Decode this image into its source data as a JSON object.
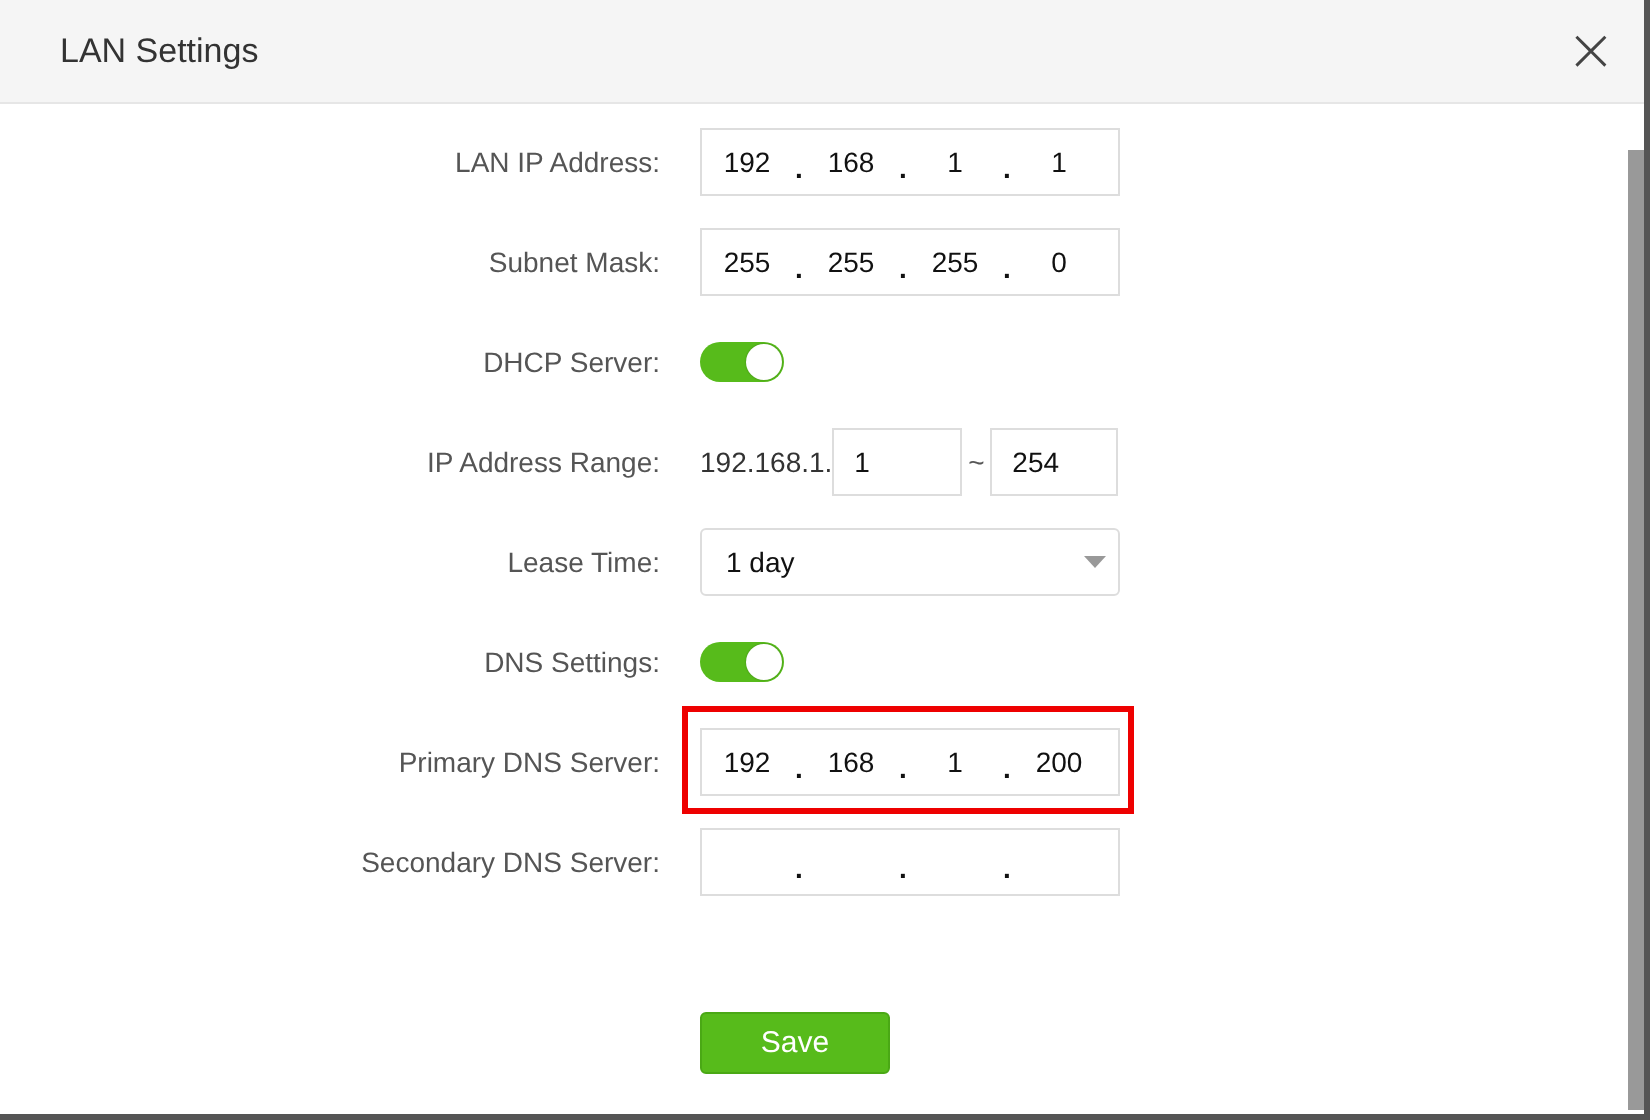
{
  "dialog": {
    "title": "LAN Settings",
    "close": "×"
  },
  "rows": [
    {
      "kind": "ip",
      "label": "LAN IP Address:",
      "separator": ".",
      "octets": [
        "192",
        "168",
        "1",
        "1"
      ],
      "highlighted": false
    },
    {
      "kind": "ip",
      "label": "Subnet Mask:",
      "separator": ".",
      "octets": [
        "255",
        "255",
        "255",
        "0"
      ],
      "highlighted": false
    },
    {
      "kind": "toggle",
      "label": "DHCP Server:",
      "on": true
    },
    {
      "kind": "range",
      "label": "IP Address Range:",
      "prefix": "192.168.1.",
      "start": "1",
      "between": "~",
      "end": "254"
    },
    {
      "kind": "select",
      "label": "Lease Time:",
      "value": "1 day"
    },
    {
      "kind": "toggle",
      "label": "DNS Settings:",
      "on": true
    },
    {
      "kind": "ip",
      "label": "Primary DNS Server:",
      "separator": ".",
      "octets": [
        "192",
        "168",
        "1",
        "200"
      ],
      "highlighted": true
    },
    {
      "kind": "ip",
      "label": "Secondary DNS Server:",
      "separator": ".",
      "highlighted": false
    }
  ],
  "save_button": "Save"
}
